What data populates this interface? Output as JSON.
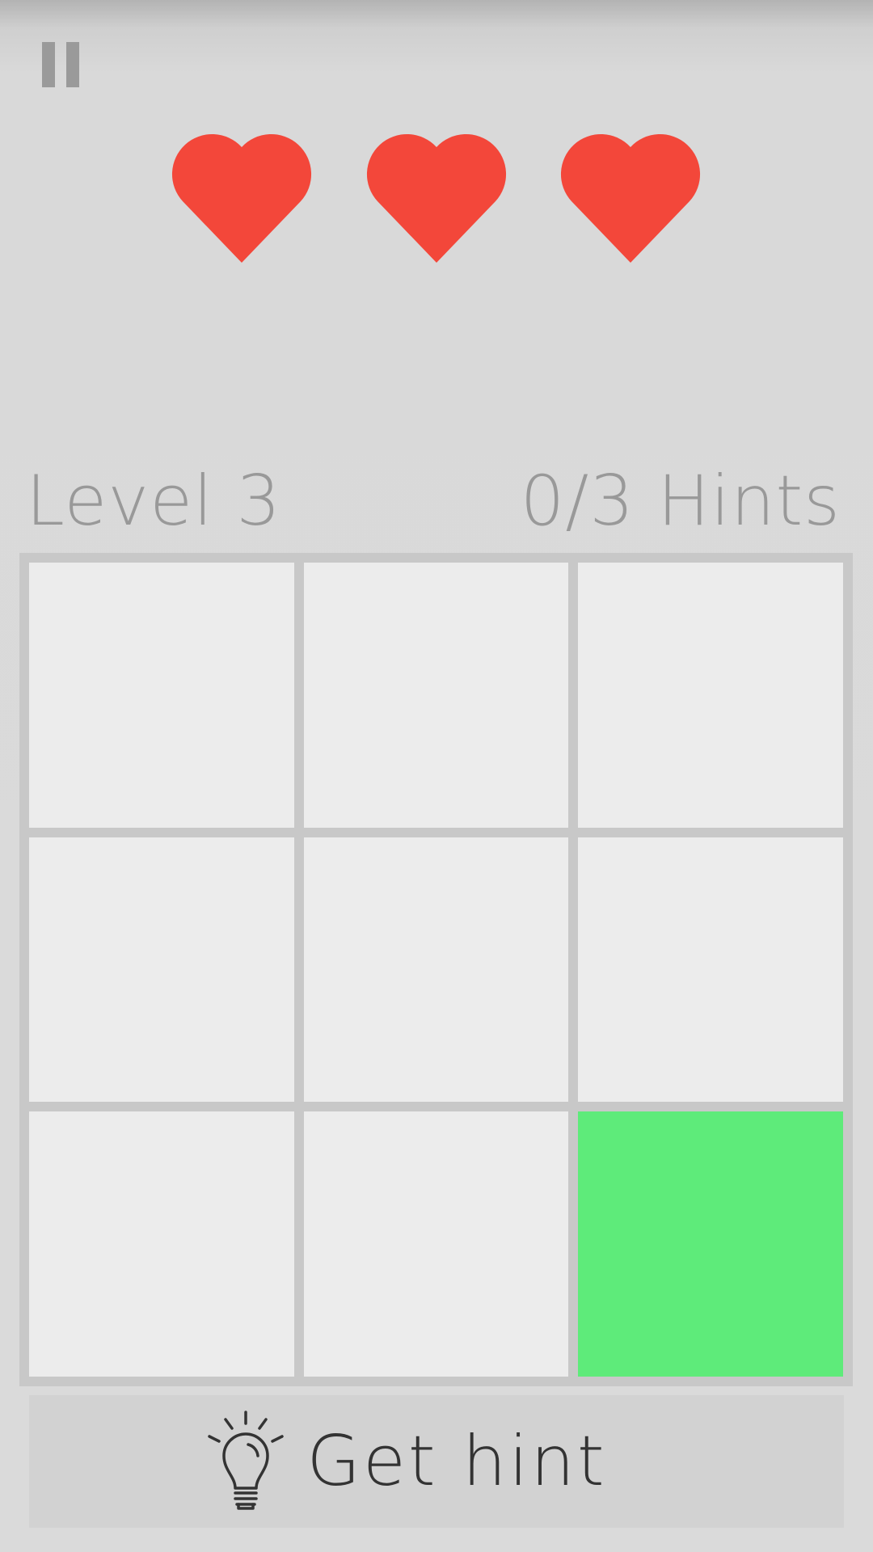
{
  "status": {
    "lives": 3,
    "heart_color": "#f3473a",
    "pause_icon": "pause-icon"
  },
  "header": {
    "level_label": "Level 3",
    "hints_label": "0/3 Hints"
  },
  "board": {
    "rows": 3,
    "cols": 3,
    "cells": [
      [
        false,
        false,
        false
      ],
      [
        false,
        false,
        false
      ],
      [
        false,
        false,
        true
      ]
    ],
    "cell_color": "#ececec",
    "active_color": "#5eeb7a"
  },
  "hint_button": {
    "label": "Get hint",
    "icon": "lightbulb-icon"
  }
}
